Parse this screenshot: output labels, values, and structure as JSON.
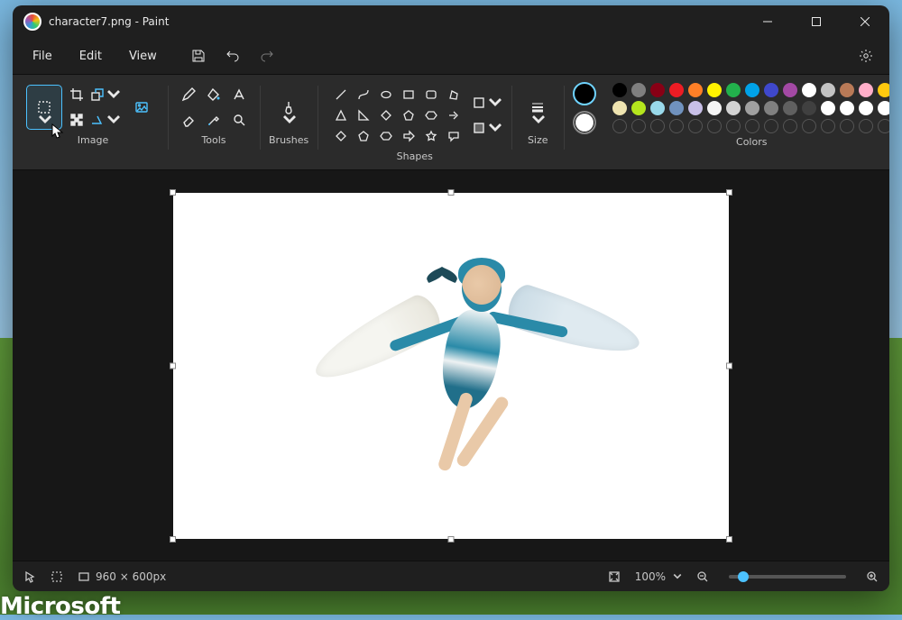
{
  "titlebar": {
    "filename": "character7.png",
    "app_suffix": " - Paint"
  },
  "menu": {
    "file": "File",
    "edit": "Edit",
    "view": "View"
  },
  "ribbon": {
    "image_label": "Image",
    "tools_label": "Tools",
    "brushes_label": "Brushes",
    "shapes_label": "Shapes",
    "size_label": "Size",
    "colors_label": "Colors"
  },
  "colors": {
    "primary": "#000000",
    "secondary": "#ffffff",
    "palette_row1": [
      "#000000",
      "#7f7f7f",
      "#880015",
      "#ed1c24",
      "#ff7f27",
      "#fff200",
      "#22b14c",
      "#00a2e8",
      "#3f48cc",
      "#a349a4",
      "#ffffff",
      "#c3c3c3",
      "#b97a57",
      "#ffaec9",
      "#ffc90e"
    ],
    "palette_row2": [
      "#efe4b0",
      "#b5e61d",
      "#99d9ea",
      "#7092be",
      "#c8bfe7",
      "#f5f5f5",
      "#d3d3d3",
      "#a0a0a0",
      "#808080",
      "#606060",
      "#404040",
      "#ffffff",
      "#ffffff",
      "#ffffff",
      "#ffffff"
    ]
  },
  "status": {
    "canvas_size": "960 × 600px",
    "zoom_text": "100%"
  },
  "watermark": "Microsoft"
}
